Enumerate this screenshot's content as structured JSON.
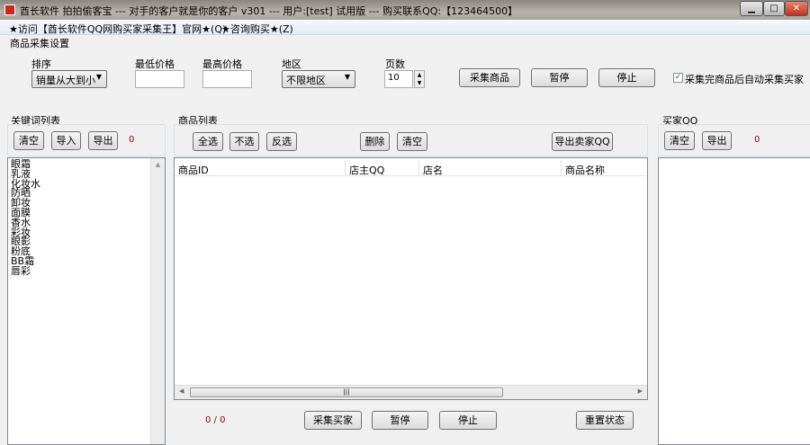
{
  "window": {
    "title": "酋长软件 拍拍偷客宝 --- 对手的客户就是你的客户 v301 --- 用户:[test] 试用版 --- 购买联系QQ:【123464500】",
    "minimize": "▁",
    "maximize": "□",
    "close": "✕"
  },
  "menu": [
    "★访问【酋长软件QQ网购买家采集王】官网★(Q)",
    "★咨询购买★(Z)"
  ],
  "settings": {
    "title": "商品采集设置",
    "sort_label": "排序",
    "sort_value": "销量从大到小",
    "min_price_label": "最低价格",
    "min_price": "",
    "max_price_label": "最高价格",
    "max_price": "",
    "region_label": "地区",
    "region_value": "不限地区",
    "pages_label": "页数",
    "pages_value": "10",
    "collect_button": "采集商品",
    "pause_button": "暂停",
    "stop_button": "停止",
    "auto_checkbox_label": "采集完商品后自动采集买家",
    "auto_checked": true
  },
  "keywords": {
    "title": "关键词列表",
    "clear": "清空",
    "import": "导入",
    "export": "导出",
    "count": "0",
    "items": [
      "眼霜",
      "乳液",
      "化妆水",
      "防晒",
      "卸妆",
      "面膜",
      "香水",
      "彩妆",
      "眼影",
      "粉底",
      "BB霜",
      "唇彩"
    ]
  },
  "products": {
    "title": "商品列表",
    "select_all": "全选",
    "select_none": "不选",
    "invert": "反选",
    "delete": "删除",
    "clear": "清空",
    "export_seller": "导出卖家QQ",
    "columns": [
      "商品ID",
      "店主QQ",
      "店名",
      "商品名称"
    ],
    "progress": "0 / 0",
    "collect_buyers": "采集买家",
    "pause": "暂停",
    "stop": "停止",
    "reset": "重置状态"
  },
  "buyers": {
    "title": "买家QQ",
    "clear": "清空",
    "export": "导出",
    "count": "0"
  }
}
